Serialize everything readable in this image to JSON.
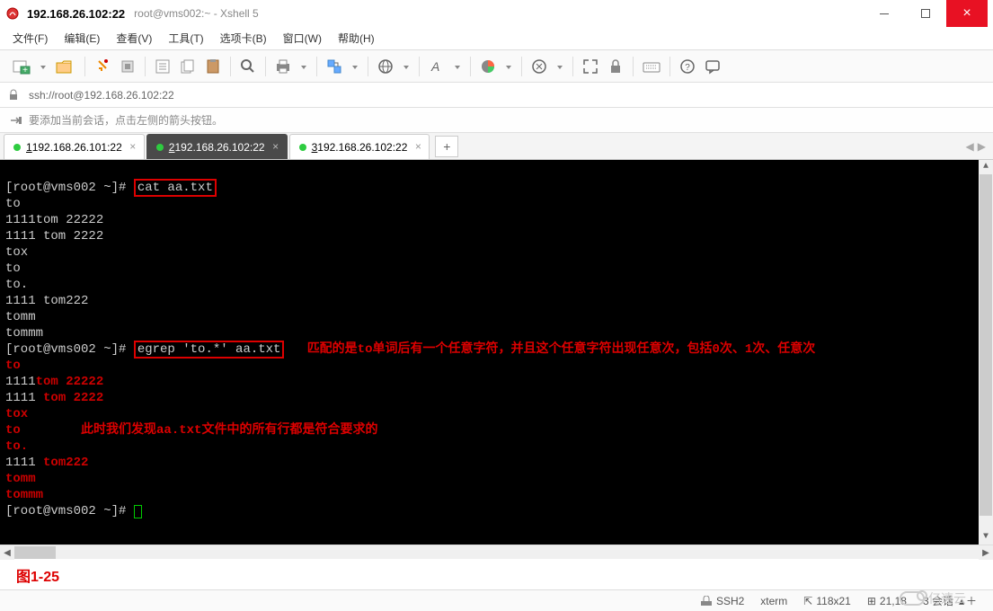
{
  "window": {
    "title_bold": "192.168.26.102:22",
    "title_sub": "root@vms002:~ - Xshell 5"
  },
  "menu": {
    "file": "文件(F)",
    "edit": "编辑(E)",
    "view": "查看(V)",
    "tools": "工具(T)",
    "tab": "选项卡(B)",
    "window": "窗口(W)",
    "help": "帮助(H)"
  },
  "addressbar": {
    "url": "ssh://root@192.168.26.102:22"
  },
  "tipbar": {
    "text": "要添加当前会话，点击左侧的箭头按钮。"
  },
  "tabs": {
    "t1": {
      "num": "1",
      "label": " 192.168.26.101:22"
    },
    "t2": {
      "num": "2",
      "label": " 192.168.26.102:22"
    },
    "t3": {
      "num": "3",
      "label": " 192.168.26.102:22"
    }
  },
  "terminal": {
    "prompt1": "[root@vms002 ~]# ",
    "cmd1": "cat aa.txt",
    "cat_out": [
      "to",
      "1111tom 22222",
      "1111 tom 2222",
      "tox",
      "to",
      "to.",
      "1111 tom222",
      "tomm",
      "tommm"
    ],
    "prompt2": "[root@vms002 ~]# ",
    "cmd2": "egrep 'to.*' aa.txt",
    "annot1": "匹配的是to单词后有一个任意字符，并且这个任意字符出现任意次，包括0次、1次、任意次",
    "grep_out": [
      {
        "pre": "",
        "hl": "to",
        "suf": ""
      },
      {
        "pre": "1111",
        "hl": "tom 22222",
        "suf": ""
      },
      {
        "pre": "1111 ",
        "hl": "tom 2222",
        "suf": ""
      },
      {
        "pre": "",
        "hl": "tox",
        "suf": ""
      },
      {
        "pre": "",
        "hl": "to",
        "suf": ""
      },
      {
        "pre": "",
        "hl": "to.",
        "suf": ""
      },
      {
        "pre": "1111 ",
        "hl": "tom222",
        "suf": ""
      },
      {
        "pre": "",
        "hl": "tomm",
        "suf": ""
      },
      {
        "pre": "",
        "hl": "tommm",
        "suf": ""
      }
    ],
    "annot2": "此时我们发现aa.txt文件中的所有行都是符合要求的",
    "prompt3": "[root@vms002 ~]# "
  },
  "figure_label": "图1-25",
  "statusbar": {
    "ssh": "SSH2",
    "term": "xterm",
    "size": "118x21",
    "pos": "21,18",
    "sessions": "3 会话"
  },
  "watermark": "亿速云",
  "icons": {
    "lock": "🔒",
    "arrow": "➪",
    "x": "×",
    "plus": "+",
    "left": "◀",
    "right": "▶",
    "updn": "↕",
    "sizei": "⇱",
    "addi": "＋",
    "connected": "⚡"
  }
}
